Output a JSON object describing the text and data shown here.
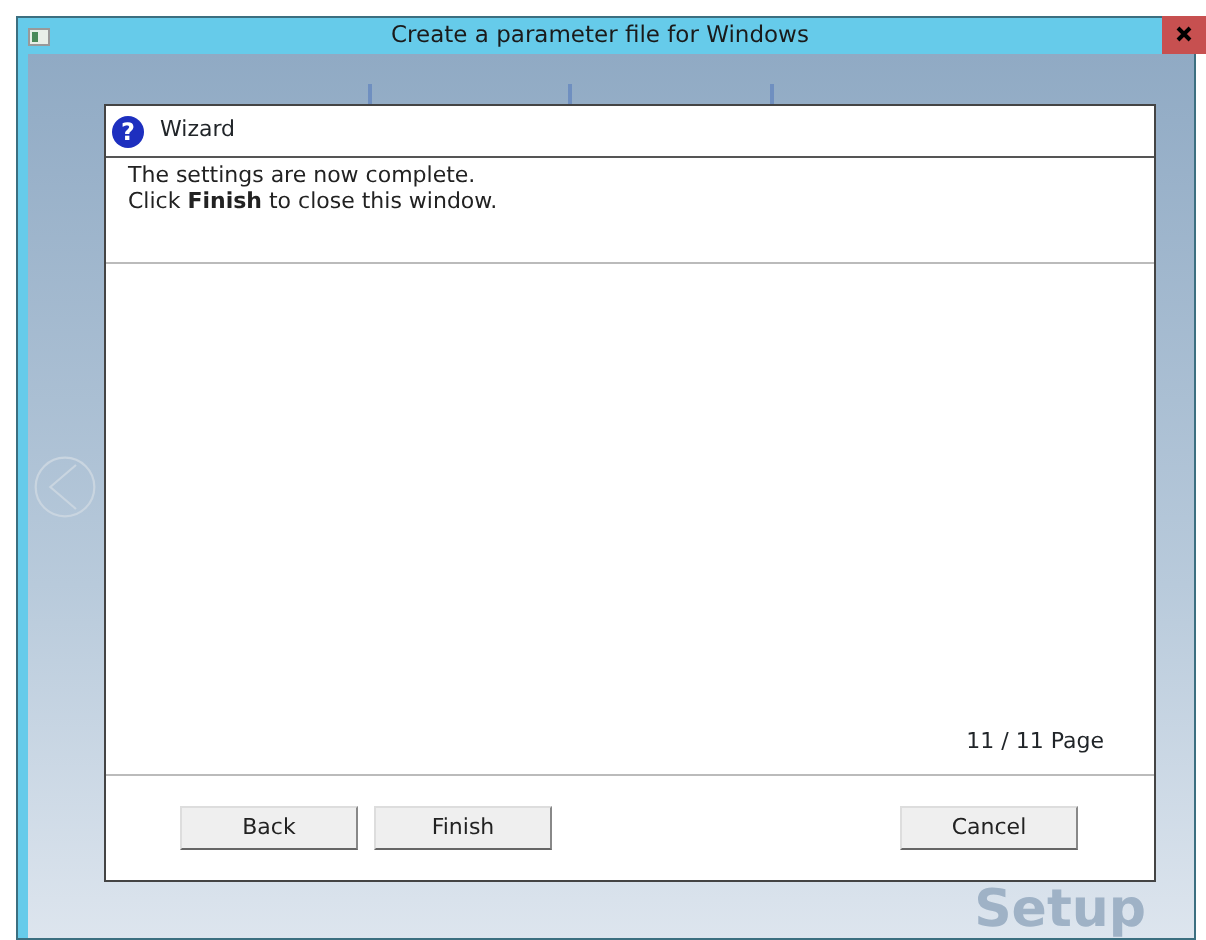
{
  "window": {
    "title": "Create a parameter file for Windows"
  },
  "background": {
    "watermark_text": "Setup"
  },
  "dialog": {
    "help_icon": "?",
    "title": "Wizard",
    "message": [
      "The settings are now complete.",
      "Click **Finish** to close this window."
    ],
    "page_indicator": "11 / 11 Page",
    "buttons": [
      {
        "label": "Back",
        "kind": "left"
      },
      {
        "label": "Finish",
        "kind": "left"
      },
      {
        "label": "Cancel",
        "kind": "right"
      }
    ]
  }
}
